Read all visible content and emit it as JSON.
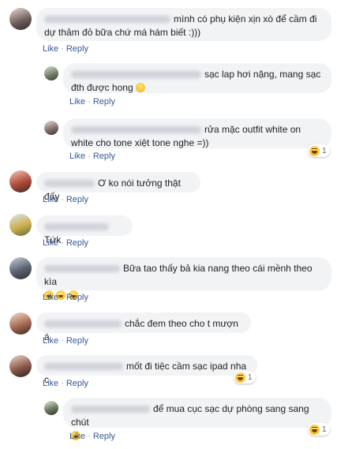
{
  "actions": {
    "like": "Like",
    "reply": "Reply",
    "sep": "·"
  },
  "comments": [
    {
      "author": "Linh Nguyễn Mai Thanh",
      "text": "mình có phụ kiện xịn xò để cầm đi dự thảm đỏ bữa chứ má hám biết :)))"
    },
    {
      "author": "Mai Nguyễn Thanh",
      "text": "sạc lap hơi nặng, mang sạc đth được hong",
      "inline_emoji": "thinking"
    },
    {
      "author": "Linh Nguyễn Thanh",
      "text": "rửa mặc outfit white on white cho tone xiệt tone nghe =))",
      "reaction_count": "1"
    },
    {
      "author": "Hùng Đặng",
      "text": "Ơ ko nói tưởng thật đấy"
    },
    {
      "author": "Hoàng Dương",
      "text": "Tứk"
    },
    {
      "author": "Trần Anh",
      "text": "Bữa tao thấy bả kia nang theo cái mềnh theo kìa",
      "emoji_row": [
        "haha",
        "haha",
        "haha"
      ]
    },
    {
      "author": "Nguyễn Hồng Ngọc",
      "text": "chắc đem theo cho t mượn á"
    },
    {
      "author": "Võ Thị Phương",
      "text": "mốt đi tiệc cầm sạc ipad nha c",
      "reaction_count": "1"
    },
    {
      "author": "Phạm Thị Tú",
      "text": "để mua cục sạc dự phòng sang sang chút",
      "reaction_count": "1"
    }
  ]
}
